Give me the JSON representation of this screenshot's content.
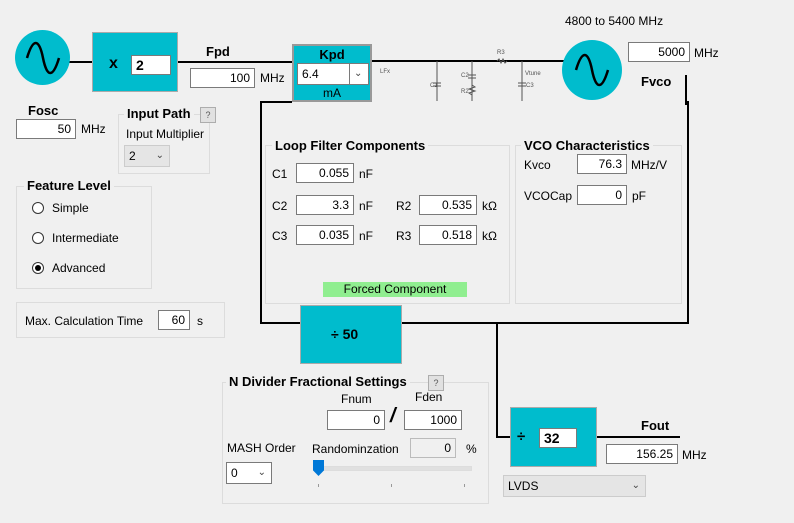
{
  "colors": {
    "accent": "#00bccd",
    "forced": "#90ee90"
  },
  "osc": {
    "label": "Fosc",
    "value": "50",
    "unit": "MHz"
  },
  "multiplier": {
    "symbol": "x",
    "value": "2"
  },
  "fpd": {
    "label": "Fpd",
    "value": "100",
    "unit": "MHz"
  },
  "kpd": {
    "label": "Kpd",
    "value": "6.4",
    "unit": "mA"
  },
  "circuit": {
    "lfx": "LFx",
    "vtune": "Vtune",
    "c1": "C1",
    "c2": "C2",
    "c3": "C3",
    "r2": "R2",
    "r3": "R3"
  },
  "vco": {
    "range": "4800 to 5400 MHz",
    "value": "5000",
    "unit": "MHz",
    "label": "Fvco"
  },
  "input_path": {
    "title": "Input Path",
    "help": "?",
    "multiplier_label": "Input Multiplier",
    "multiplier_value": "2"
  },
  "feature_level": {
    "title": "Feature Level",
    "options": [
      "Simple",
      "Intermediate",
      "Advanced"
    ],
    "selected": "Advanced"
  },
  "max_calc": {
    "label": "Max. Calculation Time",
    "value": "60",
    "unit": "s"
  },
  "loop_filter": {
    "title": "Loop Filter Components",
    "c1": {
      "label": "C1",
      "value": "0.055",
      "unit": "nF"
    },
    "c2": {
      "label": "C2",
      "value": "3.3",
      "unit": "nF"
    },
    "c3": {
      "label": "C3",
      "value": "0.035",
      "unit": "nF"
    },
    "r2": {
      "label": "R2",
      "value": "0.535",
      "unit": "kΩ"
    },
    "r3": {
      "label": "R3",
      "value": "0.518",
      "unit": "kΩ"
    },
    "forced": "Forced Component"
  },
  "vco_char": {
    "title": "VCO Characteristics",
    "kvco_label": "Kvco",
    "kvco_value": "76.3",
    "kvco_unit": "MHz/V",
    "cap_label": "VCOCap",
    "cap_value": "0",
    "cap_unit": "pF"
  },
  "n_divider": {
    "label": "÷ 50"
  },
  "n_frac": {
    "title": "N Divider Fractional Settings",
    "help": "?",
    "fnum_label": "Fnum",
    "fnum": "0",
    "slash": "/",
    "fden_label": "Fden",
    "fden": "1000",
    "mash_label": "MASH Order",
    "mash_value": "0",
    "rand_label": "Randominzation",
    "rand_value": "0",
    "rand_unit": "%",
    "slider_value": 0
  },
  "out_divider": {
    "symbol": "÷",
    "value": "32"
  },
  "fout": {
    "label": "Fout",
    "value": "156.25",
    "unit": "MHz",
    "format": "LVDS"
  }
}
